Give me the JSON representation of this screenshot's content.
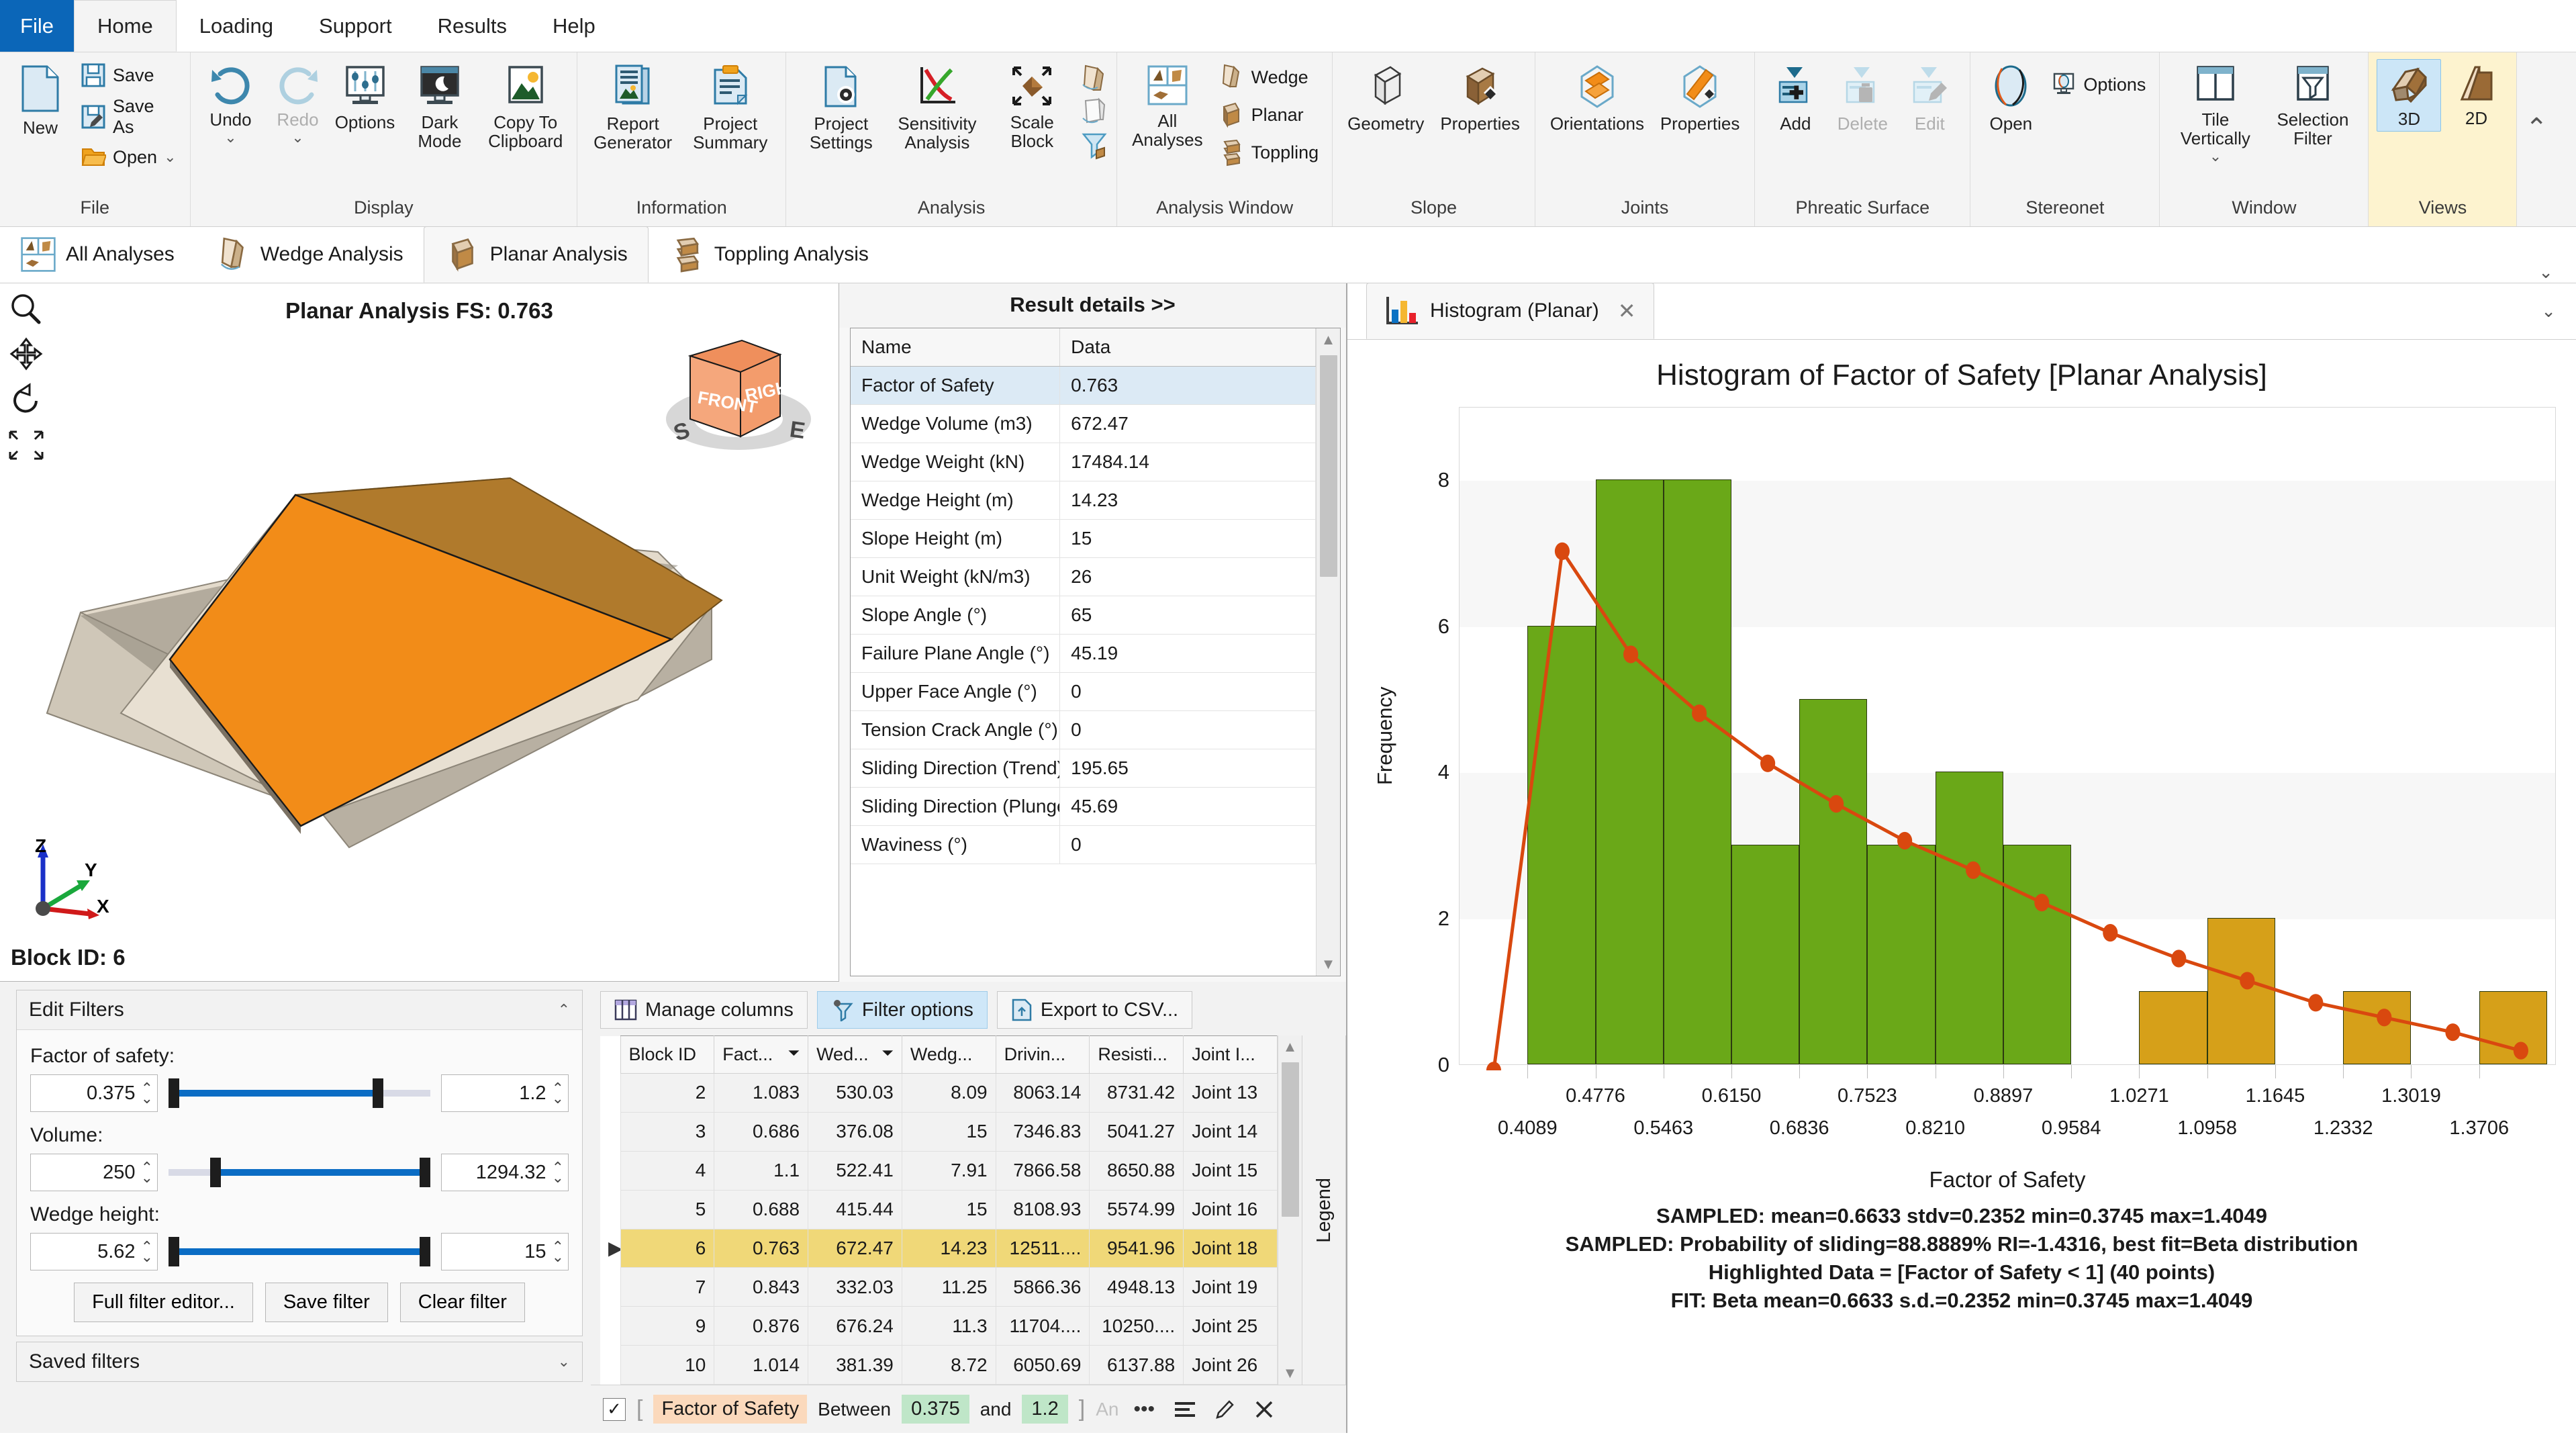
{
  "menubar": {
    "file": "File",
    "items": [
      "Home",
      "Loading",
      "Support",
      "Results",
      "Help"
    ],
    "active": "Home"
  },
  "ribbon": {
    "groups": [
      {
        "title": "File",
        "big": [
          {
            "label": "New",
            "icon": "new-document-icon"
          }
        ],
        "small": [
          {
            "label": "Save",
            "icon": "save-icon"
          },
          {
            "label": "Save As",
            "icon": "save-as-icon"
          },
          {
            "label": "Open",
            "icon": "folder-open-icon",
            "caret": true
          }
        ]
      },
      {
        "title": "Display",
        "big": [
          {
            "label": "Undo",
            "icon": "undo-icon",
            "caret": true
          },
          {
            "label": "Redo",
            "icon": "redo-icon",
            "caret": true,
            "disabled": true
          },
          {
            "label": "Options",
            "icon": "display-options-icon"
          },
          {
            "label": "Dark Mode",
            "icon": "dark-mode-icon"
          },
          {
            "label": "Copy To Clipboard",
            "icon": "copy-image-icon"
          }
        ]
      },
      {
        "title": "Information",
        "big": [
          {
            "label": "Report Generator",
            "icon": "report-generator-icon"
          },
          {
            "label": "Project Summary",
            "icon": "project-summary-icon"
          }
        ]
      },
      {
        "title": "Analysis",
        "big": [
          {
            "label": "Project Settings",
            "icon": "project-settings-icon"
          },
          {
            "label": "Sensitivity Analysis",
            "icon": "sensitivity-analysis-icon"
          },
          {
            "label": "Scale Block",
            "icon": "scale-block-icon"
          }
        ],
        "stack": [
          {
            "icon": "compute-wedge-icon"
          },
          {
            "icon": "compute-planar-icon"
          },
          {
            "icon": "filter-block-icon"
          }
        ]
      },
      {
        "title": "Analysis Window",
        "big": [
          {
            "label": "All Analyses",
            "icon": "all-analyses-icon"
          }
        ],
        "small": [
          {
            "label": "Wedge",
            "icon": "wedge-icon"
          },
          {
            "label": "Planar",
            "icon": "planar-icon"
          },
          {
            "label": "Toppling",
            "icon": "toppling-icon"
          }
        ]
      },
      {
        "title": "Slope",
        "big": [
          {
            "label": "Geometry",
            "icon": "slope-geometry-icon"
          },
          {
            "label": "Properties",
            "icon": "slope-properties-icon"
          }
        ]
      },
      {
        "title": "Joints",
        "big": [
          {
            "label": "Orientations",
            "icon": "joint-orientations-icon"
          },
          {
            "label": "Properties",
            "icon": "joint-properties-icon"
          }
        ]
      },
      {
        "title": "Phreatic Surface",
        "big": [
          {
            "label": "Add",
            "icon": "add-phreatic-icon"
          },
          {
            "label": "Delete",
            "icon": "delete-phreatic-icon",
            "disabled": true
          },
          {
            "label": "Edit",
            "icon": "edit-phreatic-icon",
            "disabled": true
          }
        ]
      },
      {
        "title": "Stereonet",
        "big": [
          {
            "label": "Open",
            "icon": "stereonet-icon"
          }
        ],
        "small": [
          {
            "label": "Options",
            "icon": "stereonet-options-icon"
          }
        ]
      },
      {
        "title": "Window",
        "big": [
          {
            "label": "Tile Vertically",
            "icon": "tile-vertically-icon",
            "caret": true
          },
          {
            "label": "Selection Filter",
            "icon": "selection-filter-icon"
          }
        ]
      },
      {
        "title": "Views",
        "highlight": true,
        "big": [
          {
            "label": "3D",
            "icon": "view-3d-icon",
            "selected": true
          },
          {
            "label": "2D",
            "icon": "view-2d-icon"
          }
        ]
      }
    ],
    "collapse_caret": "⌃"
  },
  "analysis_tabs": {
    "items": [
      {
        "label": "All Analyses",
        "icon": "all-analyses-icon"
      },
      {
        "label": "Wedge Analysis",
        "icon": "wedge-icon"
      },
      {
        "label": "Planar Analysis",
        "icon": "planar-icon"
      },
      {
        "label": "Toppling Analysis",
        "icon": "toppling-icon"
      }
    ],
    "active": "Planar Analysis",
    "caret": "⌄"
  },
  "view3d": {
    "title": "Planar Analysis FS: 0.763",
    "block_id": "Block ID: 6",
    "orientation_cube": {
      "front": "FRONT",
      "right": "RIGHT",
      "compass_s": "S",
      "compass_e": "E"
    },
    "axes": {
      "x": "X",
      "y": "Y",
      "z": "Z"
    },
    "tools": [
      "zoom-icon",
      "pan-icon",
      "rotate-icon",
      "zoom-extents-icon"
    ]
  },
  "result_details": {
    "header": "Result details >>",
    "columns": [
      "Name",
      "Data"
    ],
    "rows": [
      {
        "name": "Factor of Safety",
        "data": "0.763",
        "selected": true
      },
      {
        "name": "Wedge Volume (m3)",
        "data": "672.47"
      },
      {
        "name": "Wedge Weight (kN)",
        "data": "17484.14"
      },
      {
        "name": "Wedge Height (m)",
        "data": "14.23"
      },
      {
        "name": "Slope Height (m)",
        "data": "15"
      },
      {
        "name": "Unit Weight (kN/m3)",
        "data": "26"
      },
      {
        "name": "Slope Angle (°)",
        "data": "65"
      },
      {
        "name": "Failure Plane Angle (°)",
        "data": "45.19"
      },
      {
        "name": "Upper Face Angle (°)",
        "data": "0"
      },
      {
        "name": "Tension Crack Angle (°)",
        "data": "0"
      },
      {
        "name": "Sliding Direction (Trend)",
        "data": "195.65"
      },
      {
        "name": "Sliding Direction (Plunge)",
        "data": "45.69"
      },
      {
        "name": "Waviness (°)",
        "data": "0"
      }
    ]
  },
  "edit_filters": {
    "title": "Edit Filters",
    "collapse_icon": "chevron-up-icon",
    "fields": [
      {
        "label": "Factor of safety:",
        "min_value": "0.375",
        "max_value": "1.2",
        "fill_start_pct": 2,
        "fill_end_pct": 80
      },
      {
        "label": "Volume:",
        "min_value": "250",
        "max_value": "1294.32",
        "fill_start_pct": 18,
        "fill_end_pct": 98
      },
      {
        "label": "Wedge height:",
        "min_value": "5.62",
        "max_value": "15",
        "fill_start_pct": 2,
        "fill_end_pct": 98
      }
    ],
    "buttons": [
      "Full filter editor...",
      "Save filter",
      "Clear filter"
    ]
  },
  "saved_filters": {
    "title": "Saved filters",
    "expand_icon": "chevron-down-icon"
  },
  "grid_toolbar": [
    {
      "label": "Manage columns",
      "icon": "columns-icon",
      "active": false
    },
    {
      "label": "Filter options",
      "icon": "filter-options-icon",
      "active": true
    },
    {
      "label": "Export to CSV...",
      "icon": "export-csv-icon",
      "active": false
    }
  ],
  "data_grid": {
    "columns": [
      "Block ID",
      "Fact...",
      "Wed...",
      "Wedg...",
      "Drivin...",
      "Resisti...",
      "Joint I..."
    ],
    "filter_icon_columns": [
      1,
      2
    ],
    "rows": [
      {
        "cells": [
          "2",
          "1.083",
          "530.03",
          "8.09",
          "8063.14",
          "8731.42",
          "Joint 13"
        ]
      },
      {
        "cells": [
          "3",
          "0.686",
          "376.08",
          "15",
          "7346.83",
          "5041.27",
          "Joint 14"
        ]
      },
      {
        "cells": [
          "4",
          "1.1",
          "522.41",
          "7.91",
          "7866.58",
          "8650.88",
          "Joint 15"
        ]
      },
      {
        "cells": [
          "5",
          "0.688",
          "415.44",
          "15",
          "8108.93",
          "5574.99",
          "Joint 16"
        ]
      },
      {
        "cells": [
          "6",
          "0.763",
          "672.47",
          "14.23",
          "12511....",
          "9541.96",
          "Joint 18"
        ],
        "highlight": true,
        "marker": "▶"
      },
      {
        "cells": [
          "7",
          "0.843",
          "332.03",
          "11.25",
          "5866.36",
          "4948.13",
          "Joint 19"
        ]
      },
      {
        "cells": [
          "9",
          "0.876",
          "676.24",
          "11.3",
          "11704....",
          "10250....",
          "Joint 25"
        ]
      },
      {
        "cells": [
          "10",
          "1.014",
          "381.39",
          "8.72",
          "6050.69",
          "6137.88",
          "Joint 26"
        ]
      }
    ],
    "legend_label": "Legend"
  },
  "filter_bar": {
    "checked": "✓",
    "field": "Factor of Safety",
    "operator": "Between",
    "value_low": "0.375",
    "conjunction": "and",
    "value_high": "1.2",
    "trailing_hint": "An",
    "icons": [
      "more-options-icon",
      "list-icon",
      "edit-icon",
      "close-icon"
    ]
  },
  "histogram_tab": {
    "label": "Histogram (Planar)",
    "icon": "bar-chart-icon",
    "close": "✕",
    "caret": "⌄"
  },
  "chart_data": {
    "type": "bar",
    "title": "Histogram of Factor of Safety [Planar Analysis]",
    "xlabel": "Factor of Safety",
    "ylabel": "Frequency",
    "ylim": [
      0,
      9
    ],
    "yticks": [
      0,
      2,
      4,
      6,
      8
    ],
    "xlim": [
      0.3402,
      1.4393
    ],
    "xticks_lower": [
      "0.4089",
      "0.5463",
      "0.6836",
      "0.8210",
      "0.9584",
      "1.0958",
      "1.2332",
      "1.3706"
    ],
    "xticks_upper": [
      "0.4776",
      "0.6150",
      "0.7523",
      "0.8897",
      "1.0271",
      "1.1645",
      "1.3019"
    ],
    "bin_width": 0.0687,
    "bin_starts": [
      0.3402,
      0.4089,
      0.4776,
      0.5463,
      0.615,
      0.6836,
      0.7523,
      0.821,
      0.8897,
      0.9584,
      1.0271,
      1.0958,
      1.1645,
      1.2332,
      1.3019,
      1.3706
    ],
    "values": [
      0,
      6,
      8,
      8,
      3,
      5,
      3,
      4,
      3,
      0,
      1,
      2,
      0,
      1,
      0,
      1
    ],
    "bar_colors": [
      "#6aa818",
      "#6aa818",
      "#6aa818",
      "#6aa818",
      "#6aa818",
      "#6aa818",
      "#6aa818",
      "#6aa818",
      "#6aa818",
      "#d6a019",
      "#d6a019",
      "#d6a019",
      "#d6a019",
      "#d6a019",
      "#d6a019",
      "#d6a019"
    ],
    "highlight_color": "#6aa818",
    "unhighlight_color": "#d6a019",
    "fit_curve": {
      "name": "Beta distribution fit",
      "color": "#d9480f",
      "x": [
        0.3745,
        0.4432,
        0.512,
        0.5807,
        0.6494,
        0.7181,
        0.7868,
        0.8555,
        0.9243,
        0.993,
        1.0617,
        1.1304,
        1.1991,
        1.2678,
        1.3366,
        1.4049
      ],
      "y": [
        0.0,
        7.05,
        5.65,
        4.85,
        4.17,
        3.62,
        3.12,
        2.72,
        2.28,
        1.87,
        1.52,
        1.22,
        0.92,
        0.72,
        0.52,
        0.27
      ]
    },
    "grid": "horizontal-bands",
    "legend": "none",
    "annotations": [
      "SAMPLED: mean=0.6633 stdv=0.2352 min=0.3745 max=1.4049",
      "SAMPLED: Probability of sliding=88.8889% RI=-1.4316, best fit=Beta distribution",
      "Highlighted Data = [Factor of Safety < 1] (40 points)",
      "FIT: Beta mean=0.6633 s.d.=0.2352 min=0.3745 max=1.4049"
    ]
  },
  "colors": {
    "accent_blue": "#0b66b8",
    "selection_blue": "#cce6f7",
    "highlight_row": "#f0d878",
    "bar_green": "#6aa818",
    "bar_orange": "#d6a019",
    "fit_line": "#d9480f",
    "views_group": "#fdf3cf",
    "orange_face": "#f28c18"
  }
}
